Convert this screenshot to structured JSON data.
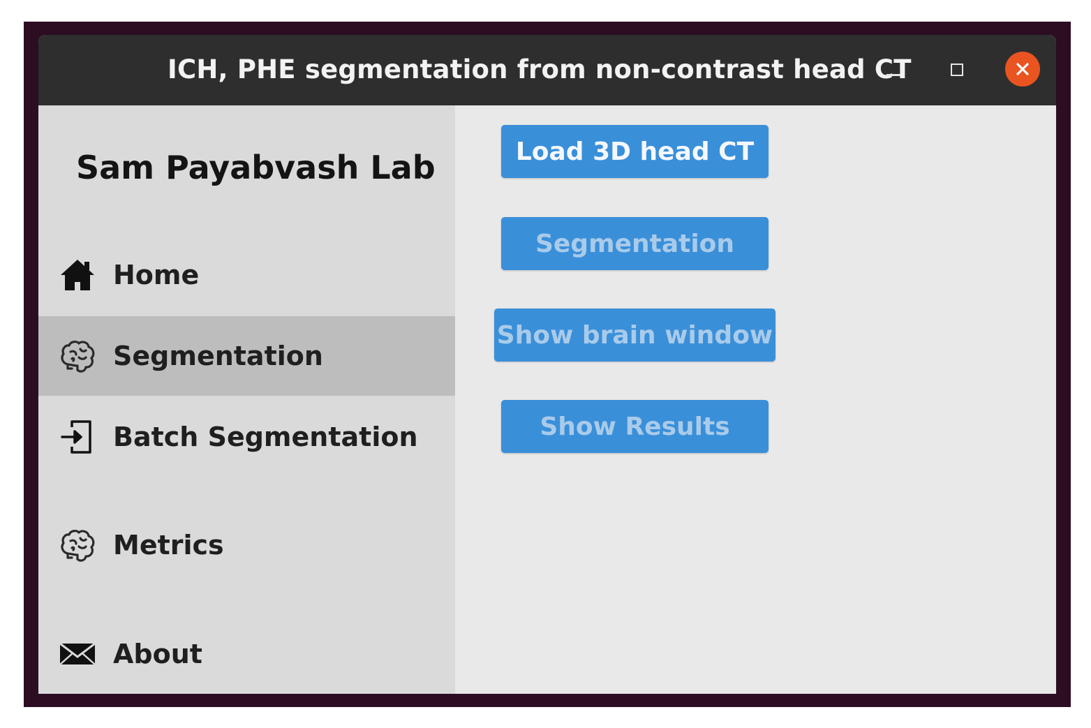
{
  "window": {
    "title": "ICH, PHE segmentation from non-contrast head CT"
  },
  "window_controls": {
    "minimize_icon": "minimize-icon",
    "maximize_icon": "maximize-icon",
    "close_icon": "close-icon",
    "close_color": "#e95420"
  },
  "sidebar": {
    "lab_title": "Sam Payabvash Lab",
    "items": [
      {
        "label": "Home",
        "icon": "home-icon",
        "active": false
      },
      {
        "label": "Segmentation",
        "icon": "brain-icon",
        "active": true
      },
      {
        "label": "Batch Segmentation",
        "icon": "sign-in-icon",
        "active": false
      },
      {
        "label": "Metrics",
        "icon": "brain-icon",
        "active": false
      },
      {
        "label": "About",
        "icon": "envelope-icon",
        "active": false
      }
    ]
  },
  "main": {
    "buttons": [
      {
        "label": "Load 3D head CT",
        "enabled": true
      },
      {
        "label": "Segmentation",
        "enabled": false
      },
      {
        "label": "Show brain window",
        "enabled": false
      },
      {
        "label": "Show Results",
        "enabled": false
      }
    ]
  },
  "colors": {
    "titlebar": "#2e2e2e",
    "sidebar": "#dadada",
    "sidebar_active": "#bdbdbd",
    "content": "#e9e9e9",
    "button": "#3a8fd9",
    "frame": "#2c0d22"
  }
}
